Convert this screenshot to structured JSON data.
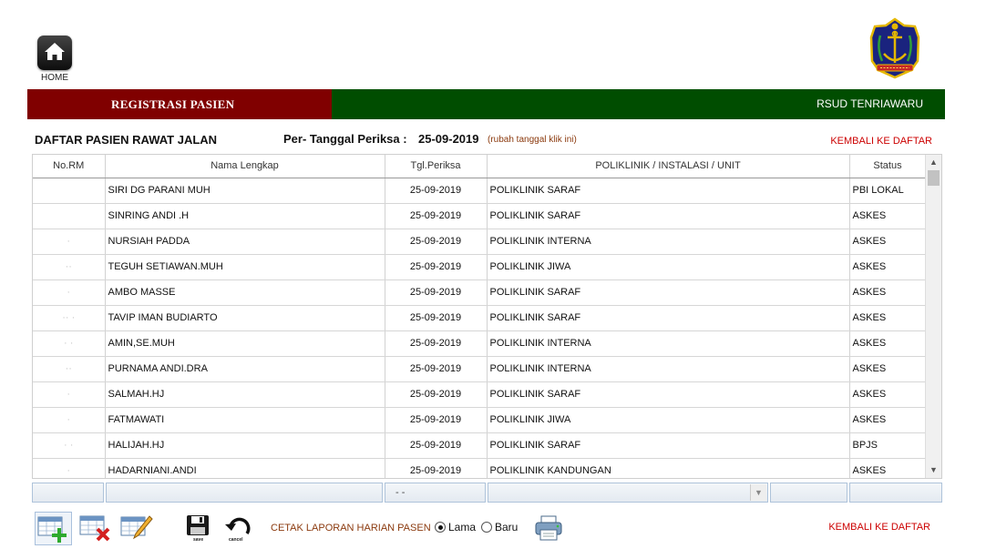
{
  "home": {
    "label": "HOME",
    "icon": "home-icon"
  },
  "logo": {
    "icon": "anchor-shield-logo"
  },
  "title_bar": {
    "left": "REGISTRASI PASIEN",
    "right": "RSUD TENRIAWARU",
    "left_color": "#800000",
    "right_color": "#004d00"
  },
  "header": {
    "list_title": "DAFTAR PASIEN RAWAT JALAN",
    "date_label": "Per- Tanggal Periksa :",
    "date_value": "25-09-2019",
    "date_hint": "(rubah tanggal klik ini)",
    "back_link": "KEMBALI KE DAFTAR"
  },
  "table": {
    "columns": [
      "No.RM",
      "Nama Lengkap",
      "Tgl.Periksa",
      "POLIKLINIK / INSTALASI / UNIT",
      "Status"
    ],
    "rows": [
      {
        "rm": "",
        "nama": "SIRI DG PARANI MUH",
        "tgl": "25-09-2019",
        "poli": "POLIKLINIK SARAF",
        "status": "PBI LOKAL"
      },
      {
        "rm": "",
        "nama": "SINRING ANDI .H",
        "tgl": "25-09-2019",
        "poli": "POLIKLINIK SARAF",
        "status": "ASKES"
      },
      {
        "rm": "·",
        "nama": "NURSIAH PADDA",
        "tgl": "25-09-2019",
        "poli": "POLIKLINIK INTERNA",
        "status": "ASKES"
      },
      {
        "rm": "··",
        "nama": "TEGUH SETIAWAN.MUH",
        "tgl": "25-09-2019",
        "poli": "POLIKLINIK JIWA",
        "status": "ASKES"
      },
      {
        "rm": "·",
        "nama": "AMBO MASSE",
        "tgl": "25-09-2019",
        "poli": "POLIKLINIK SARAF",
        "status": "ASKES"
      },
      {
        "rm": "·· ·",
        "nama": "TAVIP IMAN BUDIARTO",
        "tgl": "25-09-2019",
        "poli": "POLIKLINIK SARAF",
        "status": "ASKES"
      },
      {
        "rm": "· ·",
        "nama": "AMIN,SE.MUH",
        "tgl": "25-09-2019",
        "poli": "POLIKLINIK INTERNA",
        "status": "ASKES"
      },
      {
        "rm": "··",
        "nama": "PURNAMA ANDI.DRA",
        "tgl": "25-09-2019",
        "poli": "POLIKLINIK INTERNA",
        "status": "ASKES"
      },
      {
        "rm": "·",
        "nama": "SALMAH.HJ",
        "tgl": "25-09-2019",
        "poli": "POLIKLINIK SARAF",
        "status": "ASKES"
      },
      {
        "rm": "·",
        "nama": "FATMAWATI",
        "tgl": "25-09-2019",
        "poli": "POLIKLINIK JIWA",
        "status": "ASKES"
      },
      {
        "rm": "· ·",
        "nama": "HALIJAH.HJ",
        "tgl": "25-09-2019",
        "poli": "POLIKLINIK SARAF",
        "status": "BPJS"
      },
      {
        "rm": "·",
        "nama": "HADARNIANI.ANDI",
        "tgl": "25-09-2019",
        "poli": "POLIKLINIK KANDUNGAN",
        "status": "ASKES"
      }
    ]
  },
  "filter_row": {
    "tgl_value": "- -"
  },
  "toolbar": {
    "save_label": "save",
    "cancel_label": "cancel",
    "print_label": "CETAK LAPORAN HARIAN PASEN",
    "radio_lama": "Lama",
    "radio_baru": "Baru",
    "selected": "Lama",
    "icons": [
      "add-row-icon",
      "delete-row-icon",
      "edit-icon",
      "save-icon",
      "cancel-icon",
      "printer-icon"
    ]
  }
}
